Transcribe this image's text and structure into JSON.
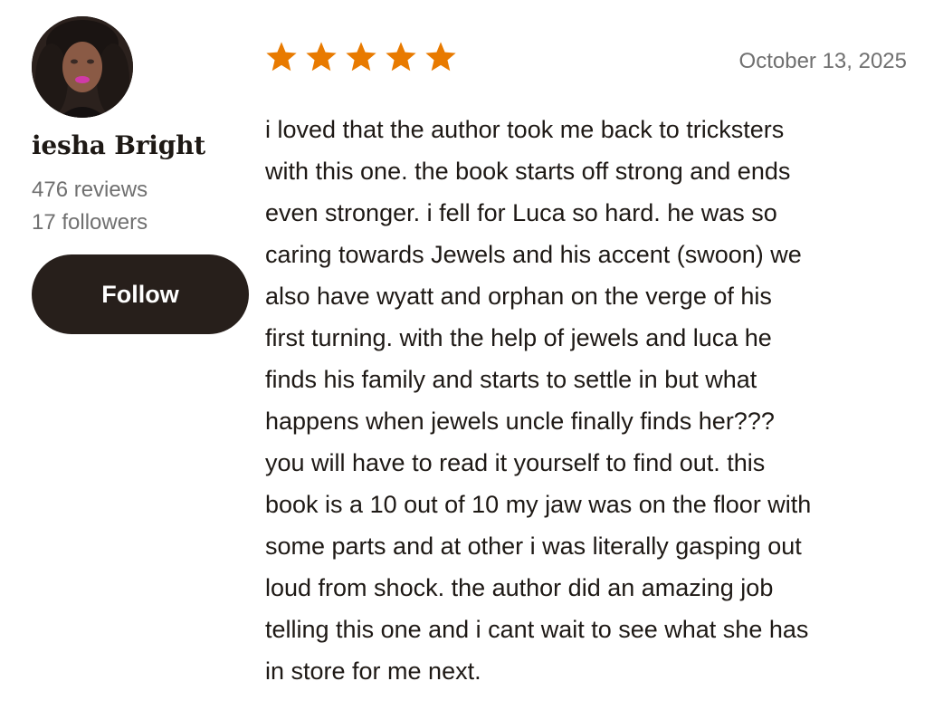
{
  "reviewer": {
    "name": "iesha Bright",
    "reviews": "476 reviews",
    "followers": "17 followers",
    "avatar_icon": "profile-photo"
  },
  "follow_button": {
    "label": "Follow"
  },
  "review": {
    "rating": 5,
    "max_rating": 5,
    "star_color": "#e87a00",
    "date": "October 13, 2025",
    "text_lines": [
      "i loved that the author took me back to tricksters",
      "with this one. the book starts off strong and ends",
      "even stronger. i fell for Luca so hard. he was so",
      "caring towards Jewels and his accent (swoon) we",
      "also have wyatt and orphan on the verge of his",
      "first turning. with the help of jewels and luca he",
      "finds his family and starts to settle in but what",
      "happens when jewels uncle finally finds her???",
      "you will have to read it yourself to find out. this",
      "book is a 10 out of 10 my jaw was on the floor with",
      "some parts and at other i was literally gasping out",
      "loud from shock. the author did an amazing job",
      "telling this one and i cant wait to see what she has",
      "in store for me next."
    ]
  }
}
